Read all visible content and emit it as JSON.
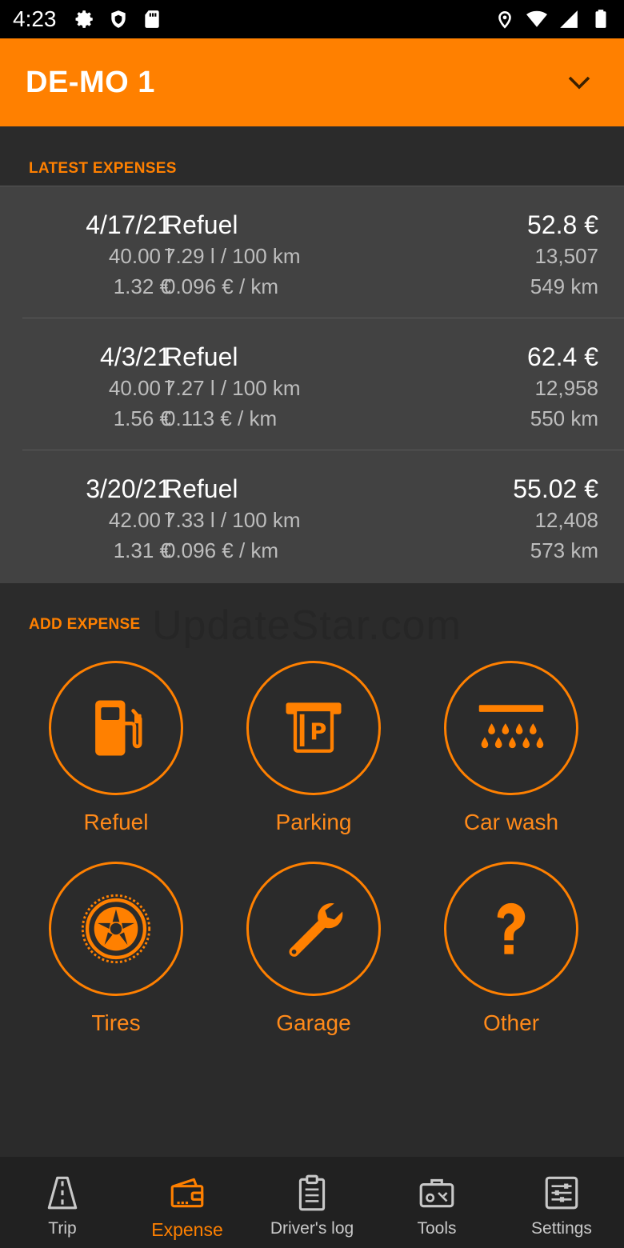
{
  "status_bar": {
    "time": "4:23"
  },
  "header": {
    "vehicle": "DE-MO 1"
  },
  "latest_expenses": {
    "title": "LATEST EXPENSES",
    "items": [
      {
        "date": "4/17/21",
        "liters": "40.00 l",
        "price_per_l": "1.32 €",
        "type": "Refuel",
        "consumption": "7.29 l / 100 km",
        "cost_per_km": "0.096 € / km",
        "amount": "52.8 €",
        "odometer": "13,507",
        "distance": "549 km"
      },
      {
        "date": "4/3/21",
        "liters": "40.00 l",
        "price_per_l": "1.56 €",
        "type": "Refuel",
        "consumption": "7.27 l / 100 km",
        "cost_per_km": "0.113 € / km",
        "amount": "62.4 €",
        "odometer": "12,958",
        "distance": "550 km"
      },
      {
        "date": "3/20/21",
        "liters": "42.00 l",
        "price_per_l": "1.31 €",
        "type": "Refuel",
        "consumption": "7.33 l / 100 km",
        "cost_per_km": "0.096 € / km",
        "amount": "55.02 €",
        "odometer": "12,408",
        "distance": "573 km"
      }
    ]
  },
  "watermark": "UpdateStar.com",
  "add_expense": {
    "title": "ADD EXPENSE",
    "tiles": [
      {
        "label": "Refuel",
        "icon": "fuel-pump-icon"
      },
      {
        "label": "Parking",
        "icon": "parking-ticket-icon"
      },
      {
        "label": "Car wash",
        "icon": "car-wash-icon"
      },
      {
        "label": "Tires",
        "icon": "tire-icon"
      },
      {
        "label": "Garage",
        "icon": "wrench-icon"
      },
      {
        "label": "Other",
        "icon": "question-mark-icon"
      }
    ]
  },
  "bottom_nav": {
    "items": [
      {
        "label": "Trip",
        "icon": "road-icon"
      },
      {
        "label": "Expense",
        "icon": "wallet-icon",
        "active": true
      },
      {
        "label": "Driver's log",
        "icon": "clipboard-icon"
      },
      {
        "label": "Tools",
        "icon": "toolbox-icon"
      },
      {
        "label": "Settings",
        "icon": "sliders-icon"
      }
    ]
  },
  "colors": {
    "accent": "#ff8000",
    "background": "#2b2b2b",
    "card": "#424242",
    "nav": "#212121"
  }
}
